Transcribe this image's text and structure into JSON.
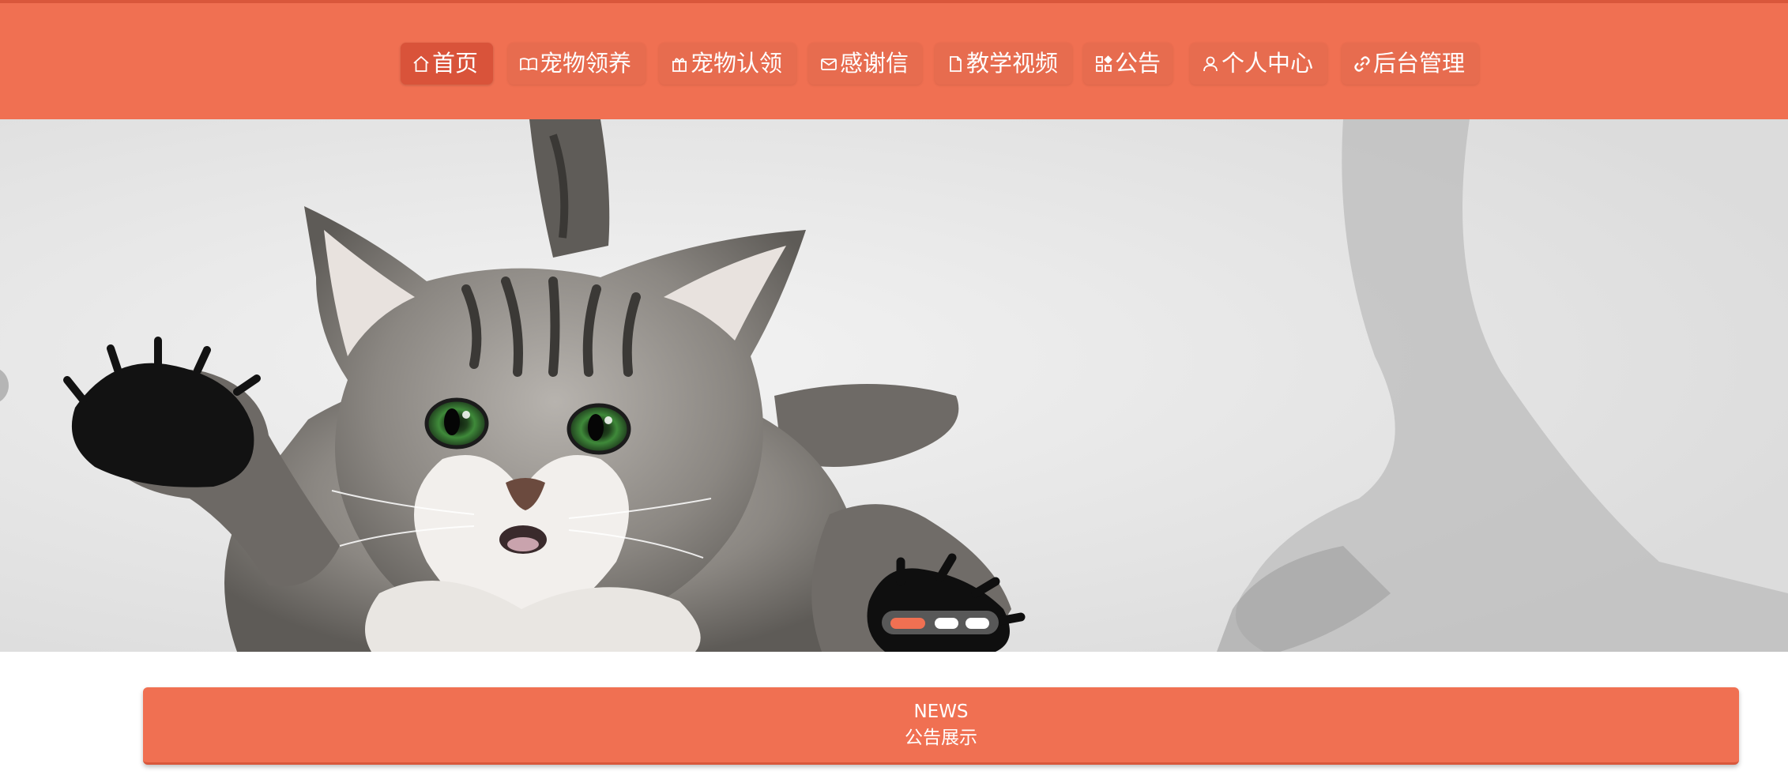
{
  "nav": {
    "items": [
      {
        "label": "首页",
        "icon": "home-icon",
        "active": true
      },
      {
        "label": "宠物领养",
        "icon": "book-open-icon",
        "active": false
      },
      {
        "label": "宠物认领",
        "icon": "gift-icon",
        "active": false
      },
      {
        "label": "感谢信",
        "icon": "mail-icon",
        "active": false
      },
      {
        "label": "教学视频",
        "icon": "document-icon",
        "active": false
      },
      {
        "label": "公告",
        "icon": "grid-icon",
        "active": false
      },
      {
        "label": "个人中心",
        "icon": "user-icon",
        "active": false
      },
      {
        "label": "后台管理",
        "icon": "link-icon",
        "active": false
      }
    ]
  },
  "carousel": {
    "slide_subject": "kitten-image",
    "current_index": 1,
    "total": 3
  },
  "news": {
    "title_en": "NEWS",
    "title_cn": "公告展示"
  },
  "colors": {
    "brand": "#f07052",
    "brand_dark": "#d9533a",
    "text_on_brand": "#ffffff"
  }
}
